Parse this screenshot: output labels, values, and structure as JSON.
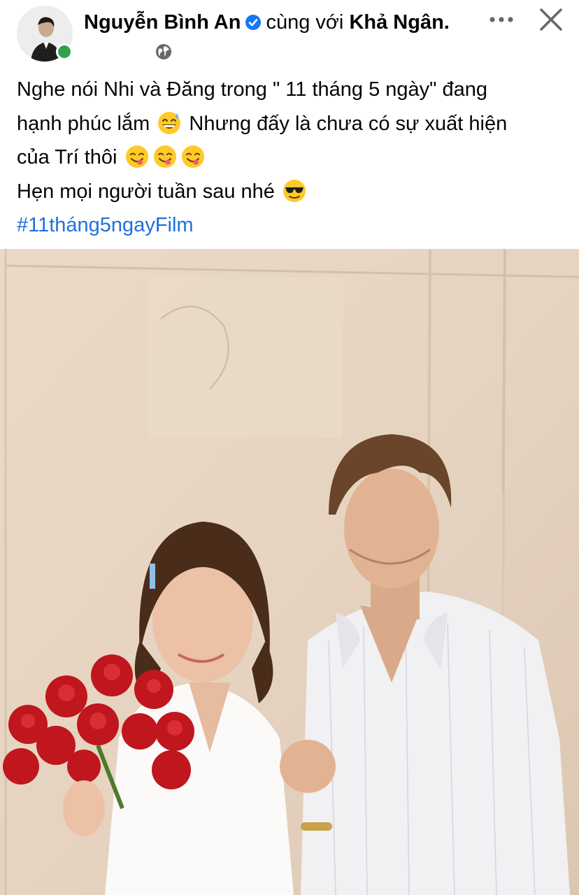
{
  "post": {
    "author": "Nguyễn Bình An",
    "with_text": "cùng với",
    "tagged": "Khả Ngân.",
    "lines": [
      "Nghe nói Nhi và Đăng trong \" 11 tháng 5 ngày\" đang",
      "hạnh phúc lắm",
      "Nhưng đấy là chưa có sự xuất hiện",
      "của Trí thôi",
      "Hẹn mọi người tuần sau nhé"
    ],
    "hashtag": "#11tháng5ngayFilm"
  },
  "icons": {
    "verified": "verified-badge-icon",
    "privacy": "globe-icon",
    "more": "more-options-icon",
    "close": "close-icon",
    "emoji_1": "grinning-sweat-emoji",
    "emoji_2": "savoring-food-emoji",
    "emoji_3": "sunglasses-emoji"
  },
  "colors": {
    "hashtag": "#216fdb",
    "verified": "#1877f2",
    "online": "#31a24c"
  }
}
